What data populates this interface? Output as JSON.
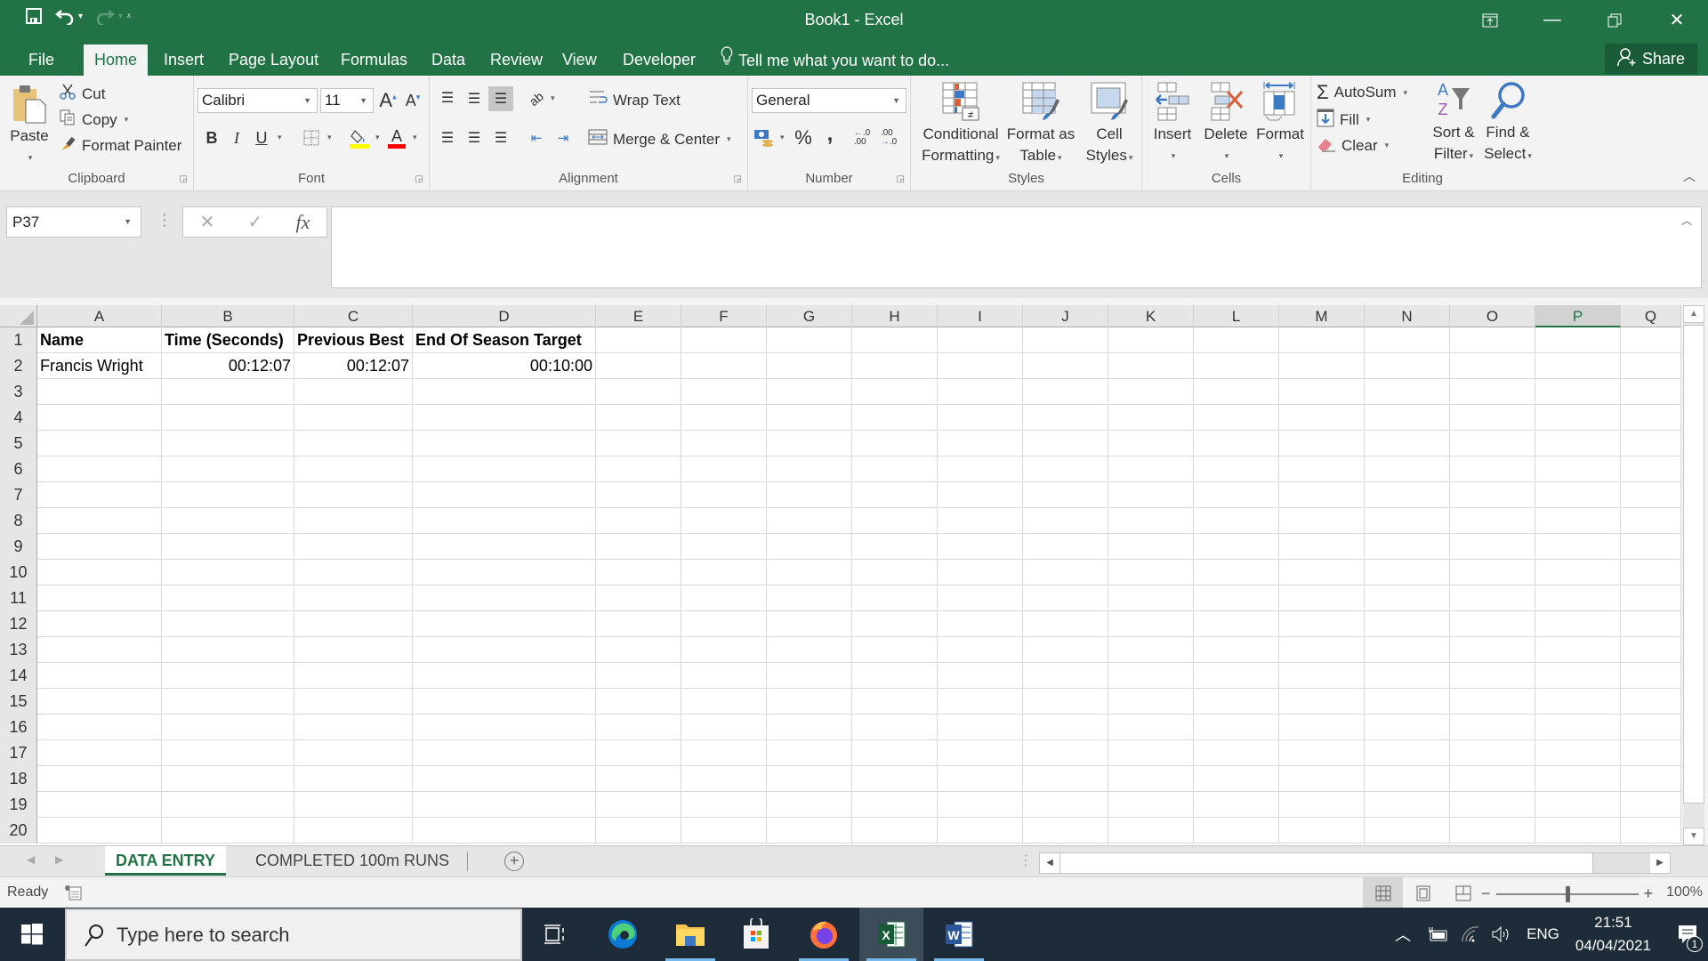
{
  "window": {
    "title": "Book1 - Excel",
    "controls": [
      "ribbon-display-options",
      "minimize",
      "restore",
      "close"
    ]
  },
  "ribbon_tabs": [
    {
      "label": "File",
      "active": false
    },
    {
      "label": "Home",
      "active": true
    },
    {
      "label": "Insert",
      "active": false
    },
    {
      "label": "Page Layout",
      "active": false
    },
    {
      "label": "Formulas",
      "active": false
    },
    {
      "label": "Data",
      "active": false
    },
    {
      "label": "Review",
      "active": false
    },
    {
      "label": "View",
      "active": false
    },
    {
      "label": "Developer",
      "active": false
    }
  ],
  "tell_me": "Tell me what you want to do...",
  "share_label": "Share",
  "ribbon": {
    "clipboard": {
      "label": "Clipboard",
      "paste": "Paste",
      "cut": "Cut",
      "copy": "Copy",
      "format_painter": "Format Painter"
    },
    "font": {
      "label": "Font",
      "font_name": "Calibri",
      "font_size": "11",
      "bold": "B",
      "italic": "I",
      "underline": "U",
      "fill_color": "#ffff00",
      "font_color": "#ff0000"
    },
    "alignment": {
      "label": "Alignment",
      "wrap_text": "Wrap Text",
      "merge_center": "Merge & Center"
    },
    "number": {
      "label": "Number",
      "format": "General",
      "percent": "%",
      "comma": ","
    },
    "styles": {
      "label": "Styles",
      "conditional_1": "Conditional",
      "conditional_2": "Formatting",
      "format_table_1": "Format as",
      "format_table_2": "Table",
      "cell_styles_1": "Cell",
      "cell_styles_2": "Styles"
    },
    "cells": {
      "label": "Cells",
      "insert": "Insert",
      "delete": "Delete",
      "format": "Format"
    },
    "editing": {
      "label": "Editing",
      "autosum": "AutoSum",
      "fill": "Fill",
      "clear": "Clear",
      "sort_1": "Sort &",
      "sort_2": "Filter",
      "find_1": "Find &",
      "find_2": "Select"
    }
  },
  "formula_bar": {
    "name_box": "P37",
    "cancel": "✕",
    "enter": "✓",
    "fx": "fx",
    "value": ""
  },
  "columns": [
    "A",
    "B",
    "C",
    "D",
    "E",
    "F",
    "G",
    "H",
    "I",
    "J",
    "K",
    "L",
    "M",
    "N",
    "O",
    "P",
    "Q"
  ],
  "selected_column": "P",
  "rows": [
    "1",
    "2",
    "3",
    "4",
    "5",
    "6",
    "7",
    "8",
    "9",
    "10",
    "11",
    "12",
    "13",
    "14",
    "15",
    "16",
    "17",
    "18",
    "19",
    "20"
  ],
  "cells": {
    "header": [
      "Name",
      "Time (Seconds)",
      "Previous Best",
      "End Of Season Target"
    ],
    "data": [
      [
        "Francis Wright",
        "00:12:07",
        "00:12:07",
        "00:10:00"
      ]
    ]
  },
  "sheets": [
    {
      "label": "DATA ENTRY",
      "active": true
    },
    {
      "label": "COMPLETED 100m RUNS",
      "active": false
    }
  ],
  "status": {
    "ready": "Ready",
    "zoom": "100%",
    "zoom_value_percent": 100
  },
  "taskbar": {
    "search_placeholder": "Type here to search",
    "apps": [
      "task-view",
      "edge",
      "file-explorer",
      "store",
      "firefox",
      "excel",
      "word"
    ],
    "active_app": "excel",
    "language": "ENG",
    "time": "21:51",
    "date": "04/04/2021",
    "notifications": "1"
  },
  "colors": {
    "excel_green": "#217346",
    "taskbar": "#1e2c3a"
  }
}
